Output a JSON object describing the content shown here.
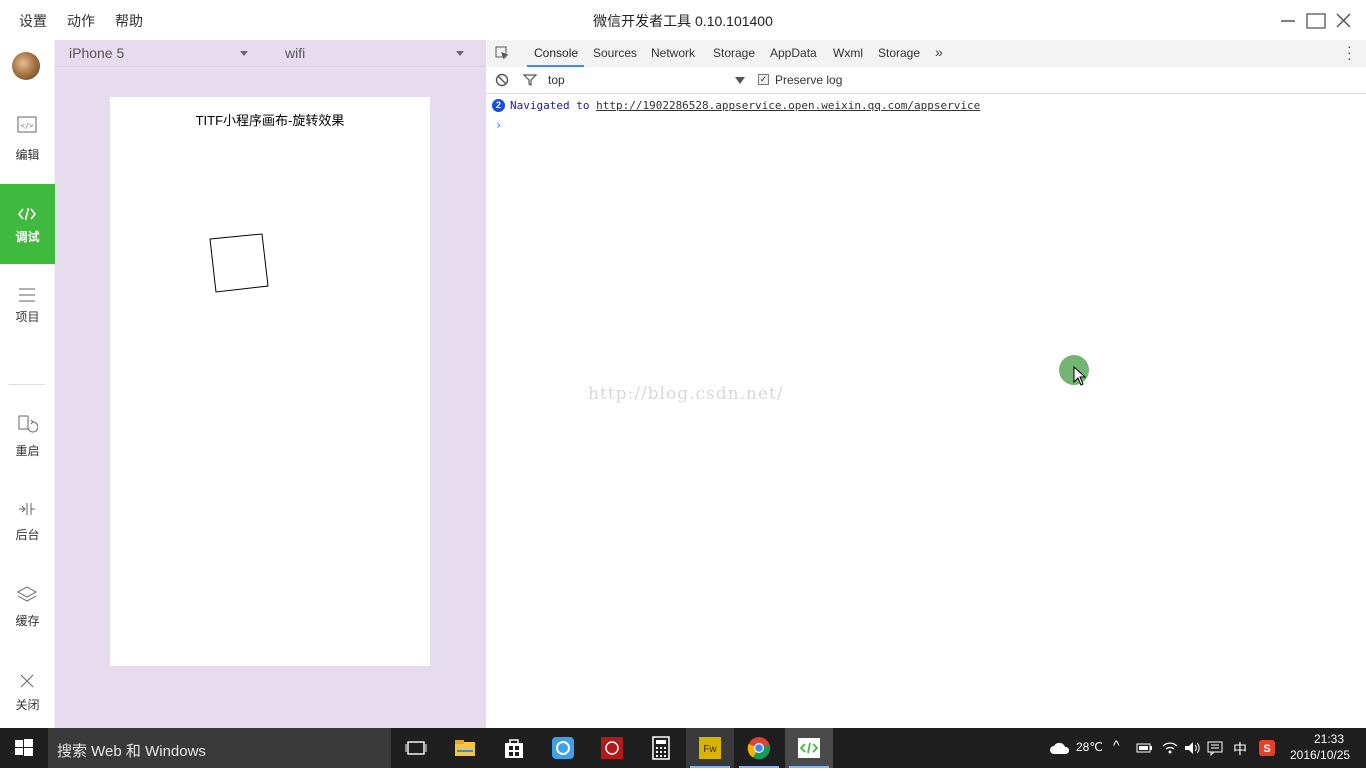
{
  "titlebar": {
    "menus": [
      "设置",
      "动作",
      "帮助"
    ],
    "title": "微信开发者工具 0.10.101400"
  },
  "sidebar": {
    "items": [
      {
        "label": "编辑",
        "icon": "code-editor-icon"
      },
      {
        "label": "调试",
        "icon": "code-brackets-icon",
        "active": true
      },
      {
        "label": "项目",
        "icon": "menu-lines-icon"
      },
      {
        "label": "重启",
        "icon": "restart-icon"
      },
      {
        "label": "后台",
        "icon": "background-icon"
      },
      {
        "label": "缓存",
        "icon": "layers-icon"
      },
      {
        "label": "关闭",
        "icon": "close-icon"
      }
    ],
    "active_color": "#3fba3f"
  },
  "simulator": {
    "device": "iPhone 5",
    "network": "wifi",
    "page_title": "TITF小程序画布-旋转效果",
    "background": "#e6dcee"
  },
  "devtools": {
    "tabs": [
      "Console",
      "Sources",
      "Network",
      "Storage",
      "AppData",
      "Wxml",
      "Storage"
    ],
    "active_tab": "Console",
    "context": "top",
    "preserve_log_label": "Preserve log",
    "preserve_log_checked": true,
    "console": {
      "count": "2",
      "message": "Navigated to ",
      "url": "http://1902286528.appservice.open.weixin.qq.com/appservice"
    },
    "watermark": "http://blog.csdn.net/"
  },
  "taskbar": {
    "search_placeholder": "搜索 Web 和 Windows",
    "apps": [
      "task-view-icon",
      "file-explorer-icon",
      "store-icon",
      "chat-app-icon",
      "red-app-icon",
      "calculator-icon",
      "fireworks-icon",
      "chrome-icon",
      "wechat-devtools-icon"
    ],
    "weather": "28℃",
    "ime": "中",
    "time": "21:33",
    "date": "2016/10/25"
  }
}
